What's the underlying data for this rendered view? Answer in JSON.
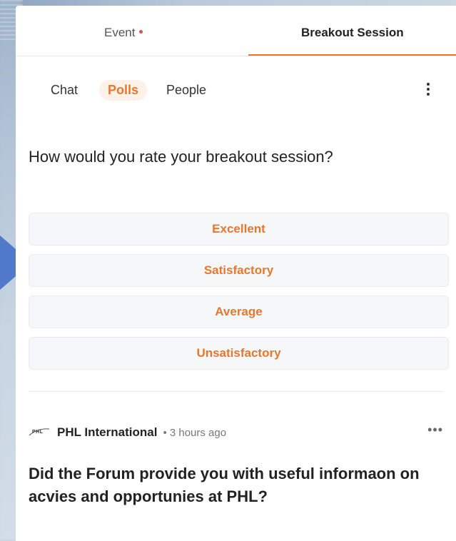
{
  "tabs": {
    "event": "Event",
    "breakout": "Breakout Session"
  },
  "subtabs": {
    "chat": "Chat",
    "polls": "Polls",
    "people": "People"
  },
  "poll": {
    "question": "How would you rate your breakout session?",
    "options": [
      "Excellent",
      "Satisfactory",
      "Average",
      "Unsatisfactory"
    ]
  },
  "post": {
    "logo_text": "PHL",
    "org": "PHL International",
    "time": "• 3 hours ago",
    "more": "•••",
    "question": "Did the Forum provide you with useful informaon on acvies and opportunies at PHL?"
  },
  "colors": {
    "accent": "#e8772e",
    "notification_dot": "#d9534f",
    "arrow": "#4b74c9"
  }
}
